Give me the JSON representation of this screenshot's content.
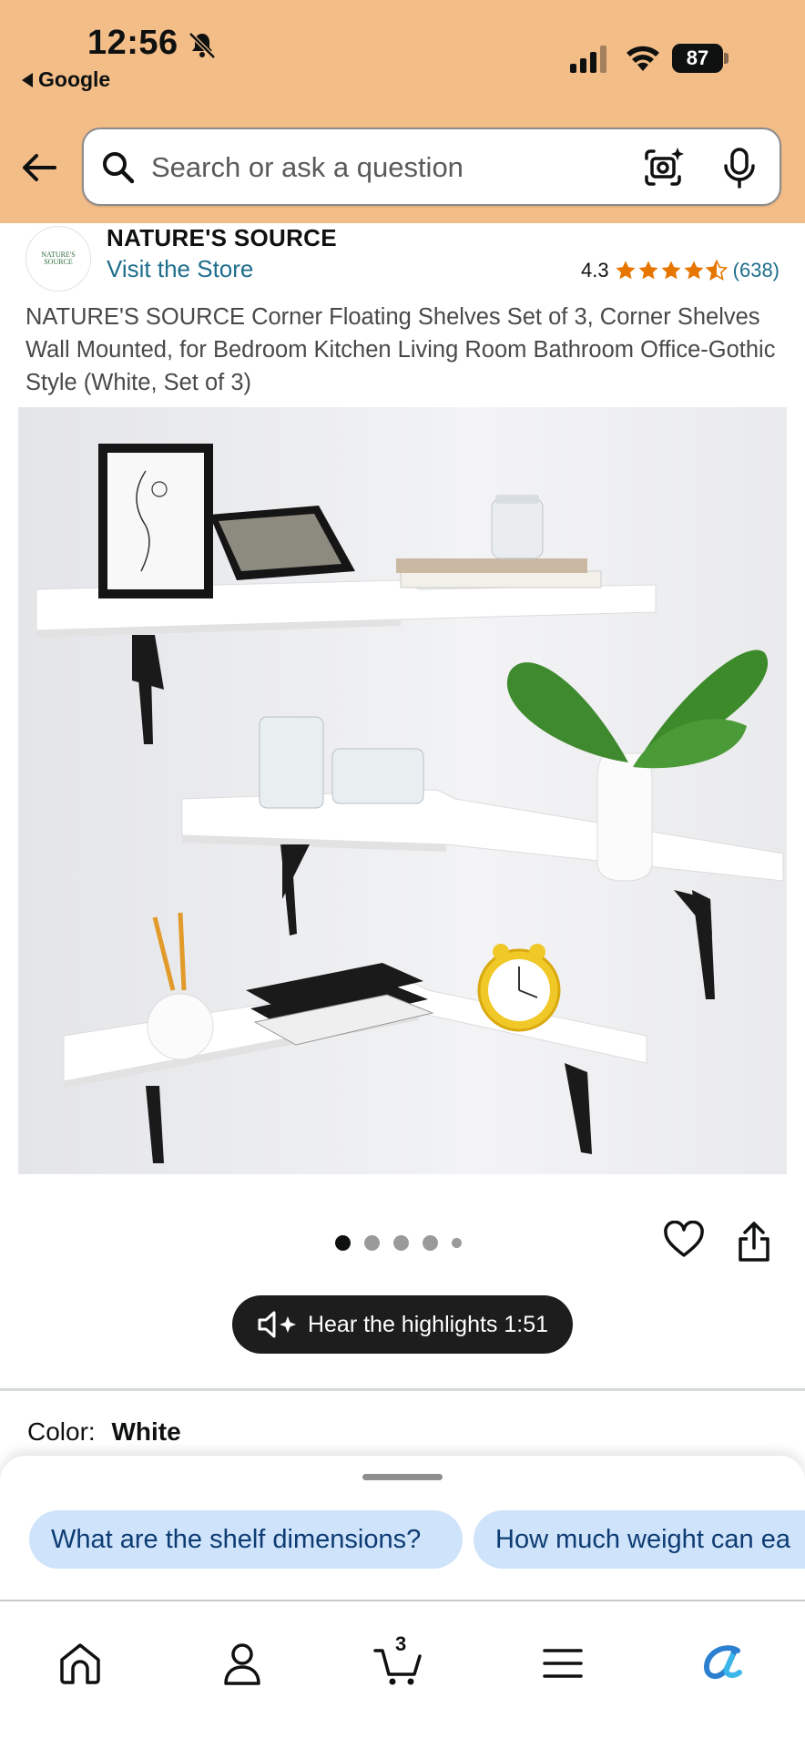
{
  "status_bar": {
    "time": "12:56",
    "back_app": "Google",
    "battery": "87"
  },
  "search": {
    "placeholder": "Search or ask a question"
  },
  "brand": {
    "logo_text": "NATURE'S SOURCE",
    "name": "NATURE'S SOURCE",
    "visit_store": "Visit the Store"
  },
  "rating": {
    "value": "4.3",
    "stars": 4.3,
    "count": "(638)"
  },
  "product": {
    "title": "NATURE'S SOURCE Corner Floating Shelves Set of 3, Corner Shelves Wall Mounted, for Bedroom Kitchen Living Room Bathroom Office-Gothic Style (White, Set of 3)",
    "image_count": 5,
    "image_index": 1
  },
  "audio": {
    "label": "Hear the highlights 1:51"
  },
  "color": {
    "label": "Color:",
    "value": "White"
  },
  "suggestions": [
    "What are the shelf dimensions?",
    "How much weight can ea"
  ],
  "tabbar": {
    "cart_count": "3",
    "icons": [
      "home-icon",
      "account-icon",
      "cart-icon",
      "menu-icon",
      "rufus-icon"
    ]
  },
  "colors": {
    "header_bg": "#f3bd88",
    "link": "#1f6e8c",
    "star": "#e77600",
    "chip_bg": "#cfe3fb"
  }
}
